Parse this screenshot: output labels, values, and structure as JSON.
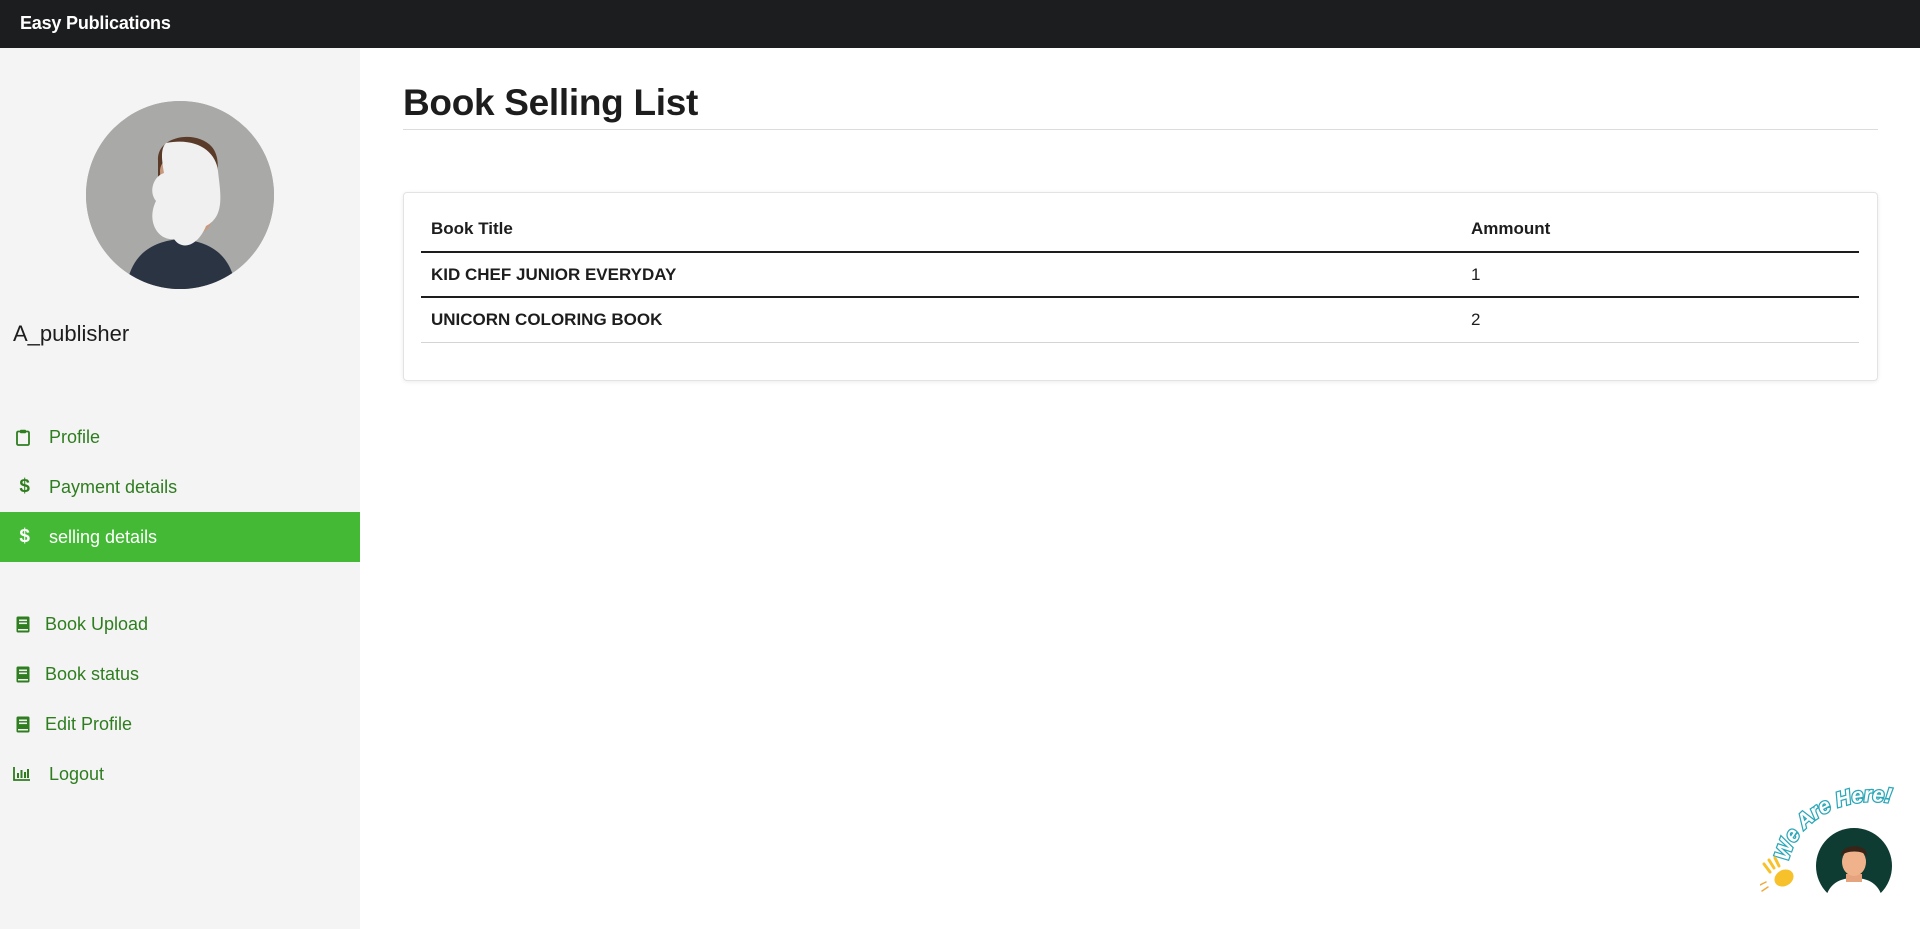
{
  "app": {
    "brand": "Easy Publications"
  },
  "sidebar": {
    "username": "A_publisher",
    "nav": [
      {
        "label": "Profile",
        "icon": "clipboard-icon"
      },
      {
        "label": "Payment details",
        "icon": "dollar-icon"
      },
      {
        "label": "selling details",
        "icon": "dollar-icon",
        "active": true
      }
    ],
    "nav2": [
      {
        "label": "Book Upload",
        "icon": "book-icon"
      },
      {
        "label": "Book status",
        "icon": "book-icon"
      },
      {
        "label": "Edit Profile",
        "icon": "book-icon"
      },
      {
        "label": "Logout",
        "icon": "bar-chart-icon"
      }
    ]
  },
  "main": {
    "title": "Book Selling List",
    "table": {
      "headers": [
        "Book Title",
        "Ammount"
      ],
      "rows": [
        [
          "KID CHEF JUNIOR EVERYDAY",
          "1"
        ],
        [
          "UNICORN COLORING BOOK",
          "2"
        ]
      ]
    }
  },
  "chat": {
    "badge_text": "We Are Here!"
  },
  "colors": {
    "accent": "#43b935",
    "nav_text": "#2e7d1f",
    "topbar": "#1c1d1f",
    "sidebar_bg": "#f4f4f4"
  }
}
